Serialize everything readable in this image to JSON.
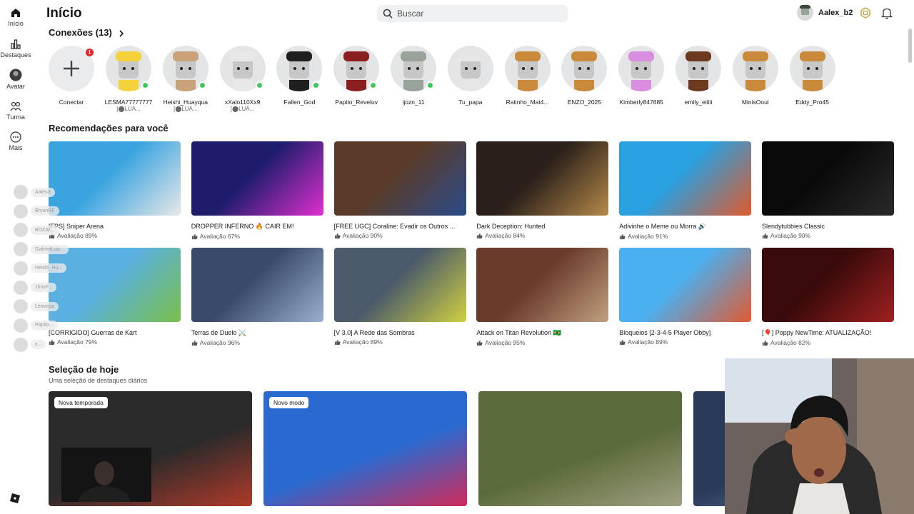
{
  "nav": {
    "items": [
      {
        "label": "Início",
        "icon": "home-icon"
      },
      {
        "label": "Destaques",
        "icon": "chart-icon"
      },
      {
        "label": "Avatar",
        "icon": "avatar-icon"
      },
      {
        "label": "Turma",
        "icon": "group-icon"
      },
      {
        "label": "Mais",
        "icon": "more-icon"
      }
    ]
  },
  "header": {
    "title": "Início",
    "search_placeholder": "Buscar",
    "username": "Aalex_b2"
  },
  "connections": {
    "title": "Conexões (13)",
    "add_label": "Conectar",
    "add_badge": "1",
    "friends": [
      {
        "name": "LESMA77777777",
        "sub": "[⬤LUA...",
        "online": true,
        "color": "#f5d23b"
      },
      {
        "name": "Heishi_Huayqua",
        "sub": "[⬤LUA...",
        "online": true,
        "color": "#c9a27a"
      },
      {
        "name": "xXalo110Xx9",
        "sub": "[⬤LUA...",
        "online": true,
        "color": "#e8e8e8"
      },
      {
        "name": "Fallen_God",
        "sub": "",
        "online": true,
        "color": "#1f1f1f"
      },
      {
        "name": "Papito_Reveluv",
        "sub": "",
        "online": true,
        "color": "#8b1f1f"
      },
      {
        "name": "ijozn_11",
        "sub": "",
        "online": true,
        "color": "#9aa39a"
      },
      {
        "name": "Tu_papa",
        "sub": "",
        "online": false,
        "color": "#e6e6e6"
      },
      {
        "name": "Ratinho_Mat4...",
        "sub": "",
        "online": false,
        "color": "#c98a3b"
      },
      {
        "name": "ENZO_2025",
        "sub": "",
        "online": false,
        "color": "#c98a3b"
      },
      {
        "name": "Kimberly847685",
        "sub": "",
        "online": false,
        "color": "#d98ee0"
      },
      {
        "name": "emily_eiiiii",
        "sub": "",
        "online": false,
        "color": "#6b3a1f"
      },
      {
        "name": "MinisOoul",
        "sub": "",
        "online": false,
        "color": "#c98a3b"
      },
      {
        "name": "Eddy_Pro45",
        "sub": "",
        "online": false,
        "color": "#c98a3b"
      }
    ]
  },
  "recommendations": {
    "title": "Recomendações para você",
    "games": [
      {
        "title": "[FPS] Sniper Arena",
        "rating": "Avaliação 89%",
        "c1": "#3aa4e0",
        "c2": "#e8e8e8"
      },
      {
        "title": "DROPPER INFERNO 🔥 CAIR EM!",
        "rating": "Avaliação 67%",
        "c1": "#1d1d6b",
        "c2": "#e02fd0"
      },
      {
        "title": "[FREE UGC] Coraline: Evadir os Outros ...",
        "rating": "Avaliação 90%",
        "c1": "#5a3b2a",
        "c2": "#2a4b8a"
      },
      {
        "title": "Dark Deception: Hunted",
        "rating": "Avaliação 84%",
        "c1": "#2a1f1a",
        "c2": "#b58a4a"
      },
      {
        "title": "Adivinhe o Meme ou Morra 🔊",
        "rating": "Avaliação 91%",
        "c1": "#2aa0e0",
        "c2": "#e05a2a"
      },
      {
        "title": "Slendytubbies Classic",
        "rating": "Avaliação 90%",
        "c1": "#0a0a0a",
        "c2": "#2a2a2a"
      },
      {
        "title": "[CORRIGIDO] Guerras de Kart",
        "rating": "Avaliação 79%",
        "c1": "#5ab0e0",
        "c2": "#7ac04a"
      },
      {
        "title": "Terras de Duelo ⚔️",
        "rating": "Avaliação 96%",
        "c1": "#3a4a6a",
        "c2": "#9ab0d0"
      },
      {
        "title": "[V 3.0] A Rede das Sombras",
        "rating": "Avaliação 89%",
        "c1": "#4a5a6a",
        "c2": "#d0d040"
      },
      {
        "title": "Attack on Titan Revolution 🇧🇷",
        "rating": "Avaliação 95%",
        "c1": "#6a3a2a",
        "c2": "#c0a080"
      },
      {
        "title": "Bloqueios [2-3-4-5 Player Obby]",
        "rating": "Avaliação 89%",
        "c1": "#4ab0f0",
        "c2": "#e05a30"
      },
      {
        "title": "[🎈] Poppy NewTime: ATUALIZAÇÃO!",
        "rating": "Avaliação 82%",
        "c1": "#3a0a0a",
        "c2": "#a02020"
      }
    ]
  },
  "today": {
    "title": "Seleção de hoje",
    "subtitle": "Uma seleção de destaques diários",
    "cards": [
      {
        "tag": "Nova temporada",
        "c1": "#2a2a2a",
        "c2": "#b03a2a"
      },
      {
        "tag": "Novo modo",
        "c1": "#2a6ad0",
        "c2": "#d02a5a"
      },
      {
        "tag": "",
        "c1": "#5a6a3a",
        "c2": "#a0a080"
      },
      {
        "tag": "",
        "c1": "#2a3a5a",
        "c2": "#6a7a9a"
      }
    ]
  },
  "chats": [
    {
      "name": "AalexX"
    },
    {
      "name": "BryanRF"
    },
    {
      "name": "BOZAr..."
    },
    {
      "name": "GabrielLuiz..."
    },
    {
      "name": "Heishi_Hu..."
    },
    {
      "name": "JhosF..."
    },
    {
      "name": "Leovepa"
    },
    {
      "name": "Papito..."
    },
    {
      "name": "x..."
    }
  ]
}
